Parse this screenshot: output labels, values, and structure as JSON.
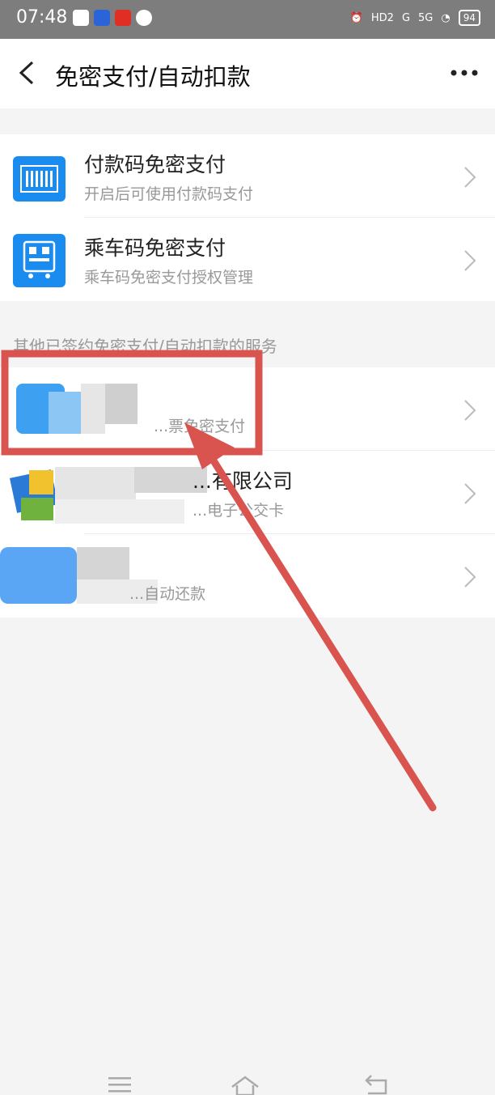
{
  "status_bar": {
    "time": "07:48",
    "signal1": "G",
    "signal2": "5G",
    "hd_badge": "HD2",
    "battery": "94"
  },
  "header": {
    "title": "免密支付/自动扣款",
    "back_icon": "chevron-left-icon",
    "more_icon": "more-dots-icon"
  },
  "main_items": [
    {
      "title": "付款码免密支付",
      "subtitle": "开启后可使用付款码支付",
      "icon": "barcode-icon"
    },
    {
      "title": "乘车码免密支付",
      "subtitle": "乘车码免密支付授权管理",
      "icon": "bus-qr-icon"
    }
  ],
  "section_label": "其他已签约免密支付/自动扣款的服务",
  "other_items": [
    {
      "title": "",
      "subtitle": "...票免密支付"
    },
    {
      "title": "...有限公司",
      "subtitle": "...电子公交卡"
    },
    {
      "title": "",
      "subtitle": "...自动还款"
    }
  ],
  "colors": {
    "accent": "#1a8cf0",
    "annotation_red": "#d9534f",
    "background": "#f4f4f4"
  }
}
